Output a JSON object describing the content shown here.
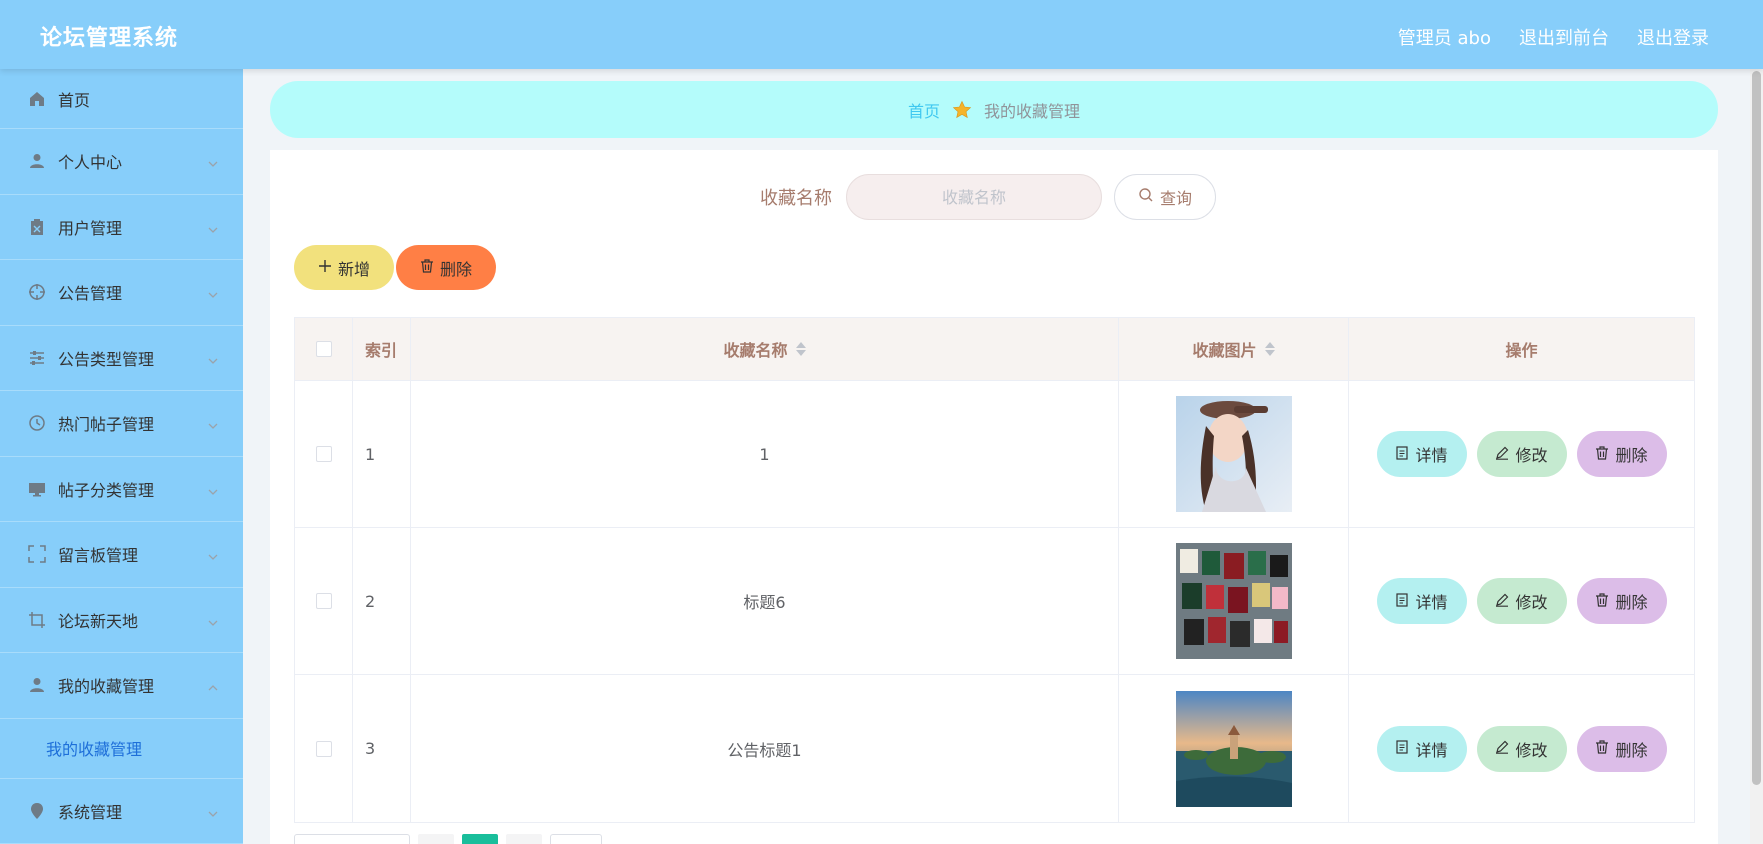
{
  "header": {
    "title": "论坛管理系统",
    "admin": "管理员 abo",
    "to_front": "退出到前台",
    "logout": "退出登录"
  },
  "sidebar": {
    "items": [
      {
        "label": "首页",
        "icon": "home-icon"
      },
      {
        "label": "个人中心",
        "icon": "user-icon"
      },
      {
        "label": "用户管理",
        "icon": "clipboard-icon"
      },
      {
        "label": "公告管理",
        "icon": "crosshair-icon"
      },
      {
        "label": "公告类型管理",
        "icon": "sliders-icon"
      },
      {
        "label": "热门帖子管理",
        "icon": "clock-icon"
      },
      {
        "label": "帖子分类管理",
        "icon": "monitor-icon"
      },
      {
        "label": "留言板管理",
        "icon": "fullscreen-icon"
      },
      {
        "label": "论坛新天地",
        "icon": "crop-icon"
      },
      {
        "label": "我的收藏管理",
        "icon": "user-icon"
      },
      {
        "label": "系统管理",
        "icon": "location-icon"
      }
    ],
    "submenu": "我的收藏管理"
  },
  "breadcrumb": {
    "home": "首页",
    "current": "我的收藏管理",
    "separator_icon": "star-icon"
  },
  "search": {
    "label": "收藏名称",
    "placeholder": "收藏名称",
    "query_button": "查询"
  },
  "actions": {
    "add": "新增",
    "delete": "删除"
  },
  "table": {
    "headers": {
      "index": "索引",
      "name": "收藏名称",
      "image": "收藏图片",
      "operations": "操作"
    },
    "rows": [
      {
        "index": "1",
        "name": "1",
        "image": "portrait-photo"
      },
      {
        "index": "2",
        "name": "标题6",
        "image": "certificates-photo"
      },
      {
        "index": "3",
        "name": "公告标题1",
        "image": "island-photo"
      }
    ],
    "row_actions": {
      "detail": "详情",
      "edit": "修改",
      "delete": "删除"
    }
  },
  "pager": {
    "active_page": ""
  },
  "colors": {
    "header_bg": "#87cefa",
    "sidebar_bg": "#87cefa",
    "breadcrumb_bg": "#b4fcfb",
    "add_button": "#f2e17d",
    "delete_button": "#ff7f45",
    "detail_button": "#b4f0f0",
    "edit_button": "#c5ead0",
    "row_delete_button": "#dcbde8",
    "accent_text": "#a67c6d",
    "pager_active": "#19be9b"
  }
}
